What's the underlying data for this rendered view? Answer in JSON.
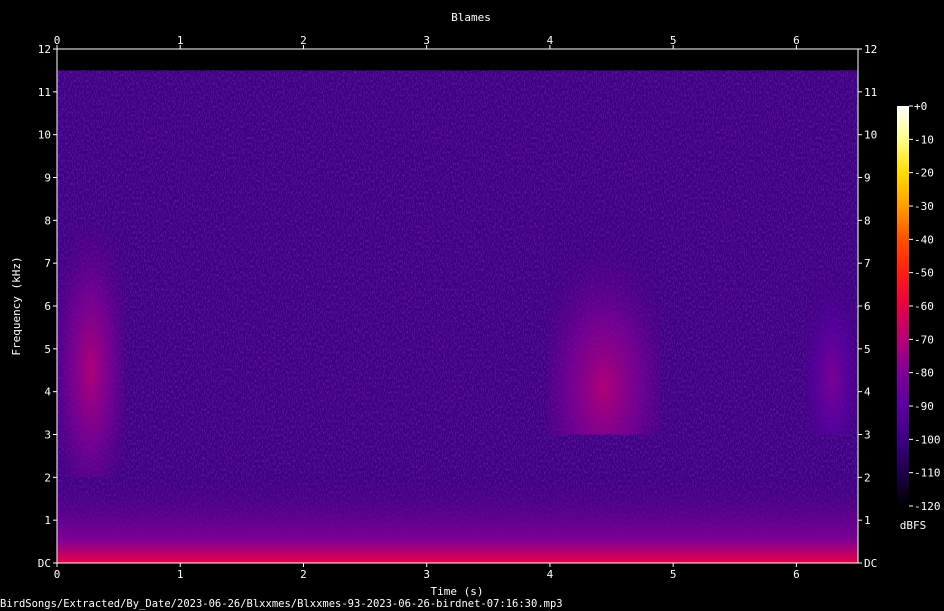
{
  "chart_data": {
    "type": "heatmap",
    "title": "Blames",
    "xlabel": "Time (s)",
    "ylabel": "Frequency (kHz)",
    "xlim": [
      0,
      6.5
    ],
    "ylim": [
      0,
      12
    ],
    "x_ticks": [
      "0",
      "1",
      "2",
      "3",
      "4",
      "5",
      "6"
    ],
    "y_ticks": [
      "DC",
      "1",
      "2",
      "3",
      "4",
      "5",
      "6",
      "7",
      "8",
      "9",
      "10",
      "11",
      "12"
    ],
    "colorbar": {
      "unit": "dBFS",
      "range": [
        -120,
        0
      ],
      "ticks": [
        "+0",
        "-10",
        "-20",
        "-30",
        "-40",
        "-50",
        "-60",
        "-70",
        "-80",
        "-90",
        "-100",
        "-110",
        "-120"
      ],
      "colors": [
        "#ffffff",
        "#ffff8c",
        "#ffdc00",
        "#ff9e00",
        "#ff5000",
        "#ff1e14",
        "#e60046",
        "#b40078",
        "#7e0096",
        "#5a00a0",
        "#3c0082",
        "#1e004b",
        "#000000"
      ]
    },
    "calls": [
      {
        "start": 0.0,
        "end": 0.55,
        "freq_low": 2.0,
        "freq_high": 7.8,
        "peak_freq": 4.5,
        "level": -72
      },
      {
        "start": 3.98,
        "end": 4.9,
        "freq_low": 3.0,
        "freq_high": 8.2,
        "peak_freq": 4.1,
        "level": -68
      },
      {
        "start": 6.08,
        "end": 6.5,
        "freq_low": 3.0,
        "freq_high": 6.8,
        "peak_freq": 4.3,
        "level": -80
      }
    ],
    "noise_floor_level": -95,
    "low_band": {
      "freq_high": 1.0,
      "level": -82
    }
  },
  "footer": {
    "file_path": "BirdSongs/Extracted/By_Date/2023-06-26/Blxxmes/Blxxmes-93-2023-06-26-birdnet-07:16:30.mp3"
  }
}
